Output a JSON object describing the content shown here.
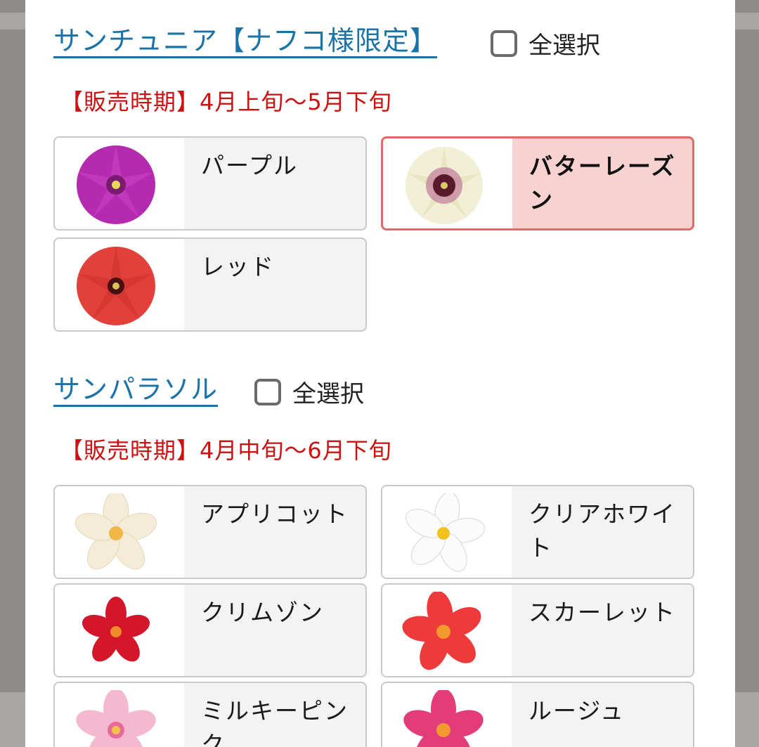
{
  "sections": [
    {
      "title": "サンチュニア【ナフコ様限定】",
      "select_all": "全選択",
      "season": "【販売時期】4月上旬〜5月下旬",
      "items": [
        {
          "label": "パープル",
          "selected": false,
          "flower_icon": "petunia-flower-icon",
          "color": "#b52bb0"
        },
        {
          "label": "バターレーズン",
          "selected": true,
          "flower_icon": "petunia-flower-icon",
          "color": "#f1efd6"
        },
        {
          "label": "レッド",
          "selected": false,
          "flower_icon": "petunia-flower-icon",
          "color": "#e2403a"
        }
      ]
    },
    {
      "title": "サンパラソル",
      "select_all": "全選択",
      "season": "【販売時期】4月中旬〜6月下旬",
      "items": [
        {
          "label": "アプリコット",
          "selected": false,
          "flower_icon": "mandevilla-flower-icon",
          "color": "#f4ecd6"
        },
        {
          "label": "クリアホワイト",
          "selected": false,
          "flower_icon": "mandevilla-flower-icon",
          "color": "#fbfbfb"
        },
        {
          "label": "クリムゾン",
          "selected": false,
          "flower_icon": "mandevilla-flower-icon",
          "color": "#d4162b"
        },
        {
          "label": "スカーレット",
          "selected": false,
          "flower_icon": "mandevilla-flower-icon",
          "color": "#ee3a3a"
        },
        {
          "label": "ミルキーピンク",
          "selected": false,
          "flower_icon": "mandevilla-flower-icon",
          "color": "#f4b8cf"
        },
        {
          "label": "ルージュ",
          "selected": false,
          "flower_icon": "mandevilla-flower-icon",
          "color": "#e23d79"
        }
      ]
    }
  ],
  "colors": {
    "link": "#1a73a8",
    "season_text": "#cc1111",
    "selected_border": "#e26a66",
    "selected_background": "#f7d2d1"
  }
}
